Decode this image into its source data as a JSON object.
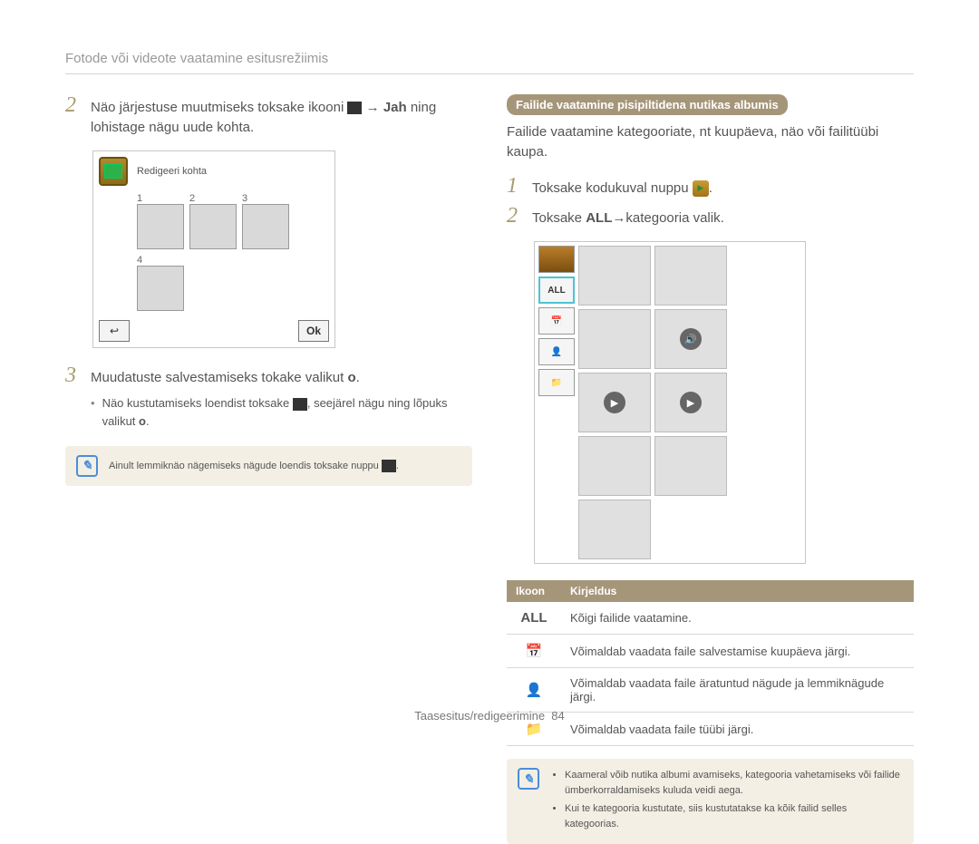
{
  "header": {
    "title": "Fotode või videote vaatamine esitusrežiimis"
  },
  "left": {
    "step2": {
      "num": "2",
      "text_pre": "Näo järjestuse muutmiseks toksake ikooni ",
      "text_mid": " → ",
      "text_bold": "Jah",
      "text_post": " ning lohistage nägu uude kohta."
    },
    "editScreen": {
      "title": "Redigeeri kohta",
      "cells": [
        "1",
        "2",
        "3",
        "4"
      ],
      "back": "↩",
      "ok": "Ok"
    },
    "step3": {
      "num": "3",
      "text_pre": "Muudatuste salvestamiseks tokake valikut ",
      "ok": "o"
    },
    "bullet": {
      "pre": "Näo kustutamiseks loendist toksake ",
      "mid": ", seejärel nägu ning lõpuks valikut ",
      "ok": "o"
    },
    "note": "Ainult lemmiknäo nägemiseks nägude loendis toksake nuppu "
  },
  "right": {
    "pill": "Failide vaatamine pisipiltidena nutikas albumis",
    "intro": "Failide vaatamine kategooriate, nt kuupäeva, näo või failitüübi kaupa.",
    "step1": {
      "num": "1",
      "text": "Toksake kodukuval nuppu "
    },
    "step2": {
      "num": "2",
      "text_pre": "Toksake ",
      "text_bold": "ALL",
      "text_post": "→kategooria valik."
    },
    "albumTabs": {
      "all": "ALL",
      "calendar": "📅",
      "face": "👤",
      "folder": "📁"
    },
    "table": {
      "head1": "Ikoon",
      "head2": "Kirjeldus",
      "rows": [
        {
          "icon": "ALL",
          "desc": "Kõigi failide vaatamine."
        },
        {
          "icon": "📅",
          "desc": "Võimaldab vaadata faile salvestamise kuupäeva järgi."
        },
        {
          "icon": "👤",
          "desc": "Võimaldab vaadata faile äratuntud nägude ja lemmiknägude järgi."
        },
        {
          "icon": "📁",
          "desc": "Võimaldab vaadata faile tüübi järgi."
        }
      ]
    },
    "note": {
      "items": [
        "Kaameral võib nutika albumi avamiseks, kategooria vahetamiseks või failide ümberkorraldamiseks kuluda veidi aega.",
        "Kui te kategooria kustutate, siis kustutatakse ka kõik failid selles kategoorias."
      ]
    }
  },
  "footer": {
    "section": "Taasesitus/redigeerimine",
    "page": "84"
  }
}
